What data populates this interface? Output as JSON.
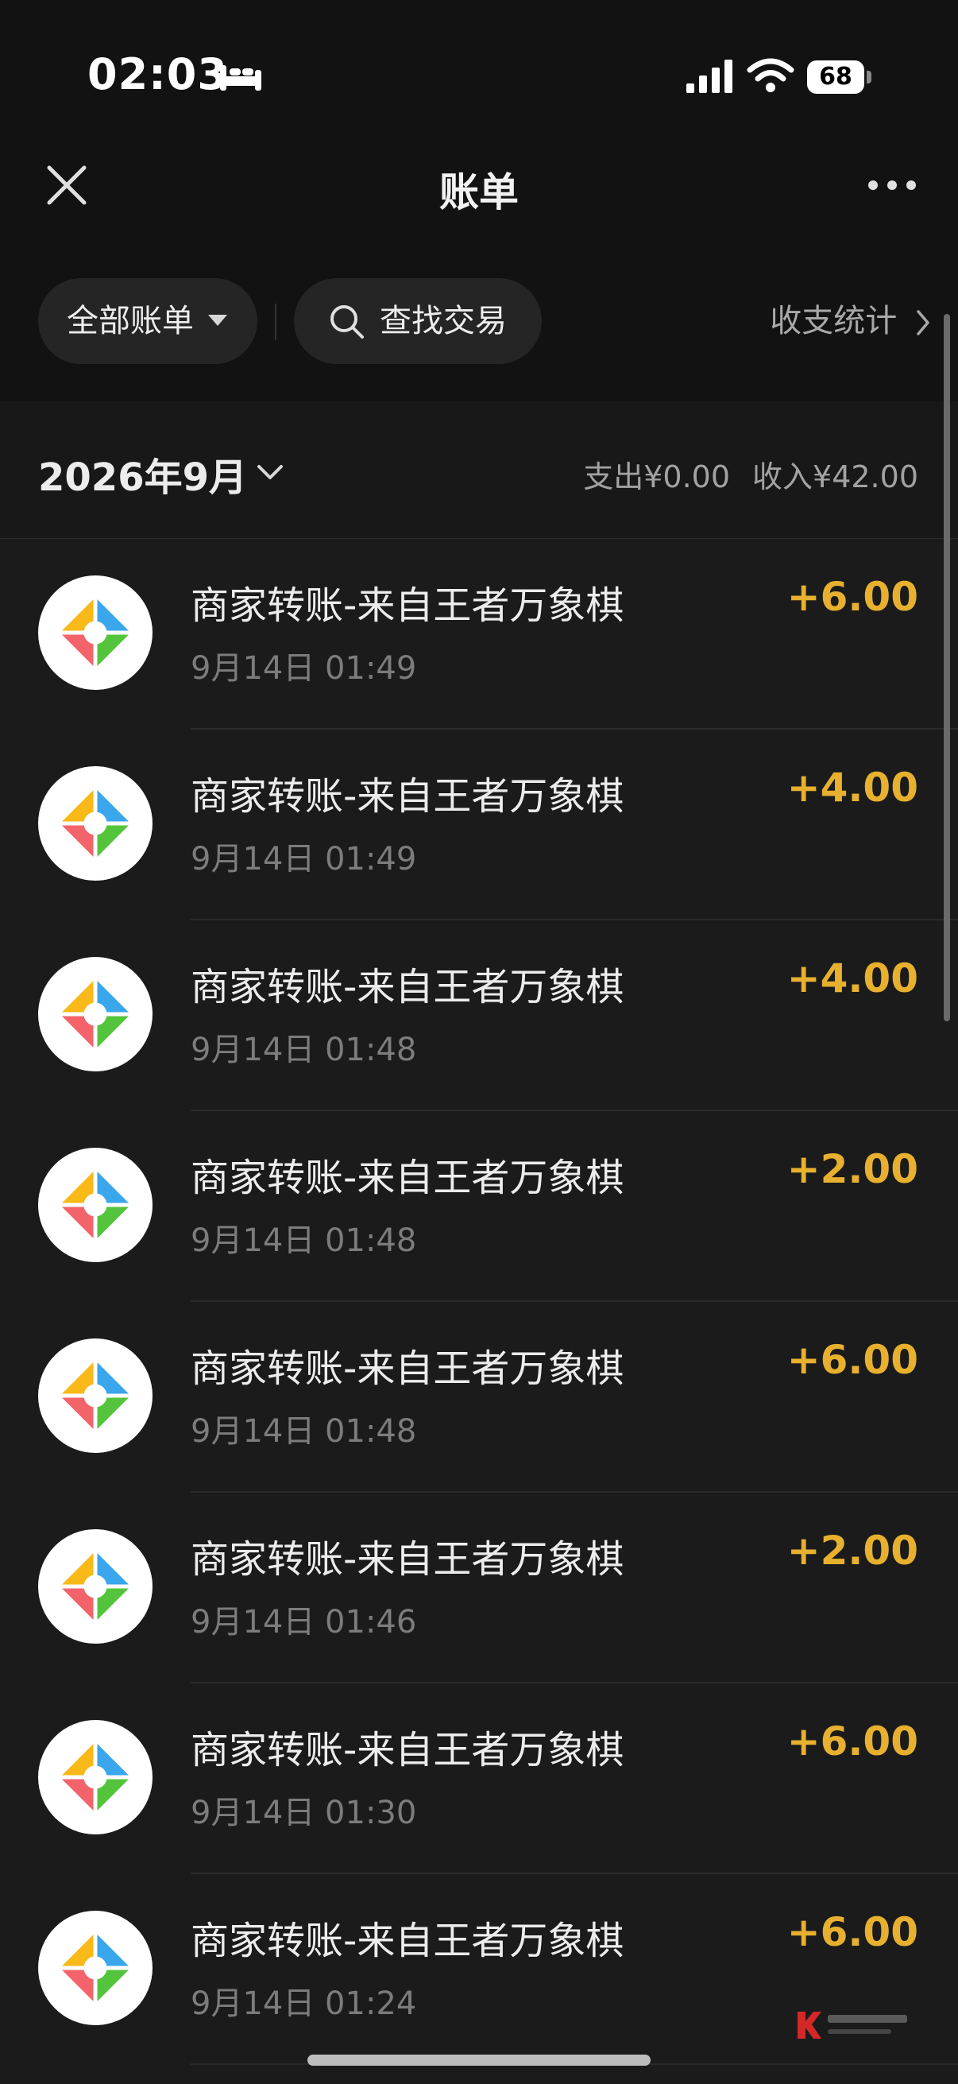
{
  "status_bar": {
    "time": "02:03",
    "battery": "68"
  },
  "nav": {
    "title": "账单"
  },
  "filters": {
    "all_bills": "全部账单",
    "search": "查找交易",
    "stats": "收支统计"
  },
  "month_header": {
    "month": "2026年9月",
    "expense": "支出¥0.00",
    "income": "收入¥42.00"
  },
  "transactions": [
    {
      "title": "商家转账-来自王者万象棋",
      "time": "9月14日 01:49",
      "amount": "+6.00"
    },
    {
      "title": "商家转账-来自王者万象棋",
      "time": "9月14日 01:49",
      "amount": "+4.00"
    },
    {
      "title": "商家转账-来自王者万象棋",
      "time": "9月14日 01:48",
      "amount": "+4.00"
    },
    {
      "title": "商家转账-来自王者万象棋",
      "time": "9月14日 01:48",
      "amount": "+2.00"
    },
    {
      "title": "商家转账-来自王者万象棋",
      "time": "9月14日 01:48",
      "amount": "+6.00"
    },
    {
      "title": "商家转账-来自王者万象棋",
      "time": "9月14日 01:46",
      "amount": "+2.00"
    },
    {
      "title": "商家转账-来自王者万象棋",
      "time": "9月14日 01:30",
      "amount": "+6.00"
    },
    {
      "title": "商家转账-来自王者万象棋",
      "time": "9月14日 01:24",
      "amount": "+6.00"
    }
  ],
  "icons": {
    "close": "close-icon",
    "more": "more-icon",
    "search": "search-icon",
    "dropdown": "triangle-down-icon",
    "chevron": "chevron-right-icon",
    "merchant_logo": "merchant-logo-icon"
  },
  "colors": {
    "amount": "#e7b02e",
    "logo_yellow": "#f8b919",
    "logo_blue": "#3aa6ec",
    "logo_green": "#54c43c",
    "logo_red": "#f2646a"
  }
}
